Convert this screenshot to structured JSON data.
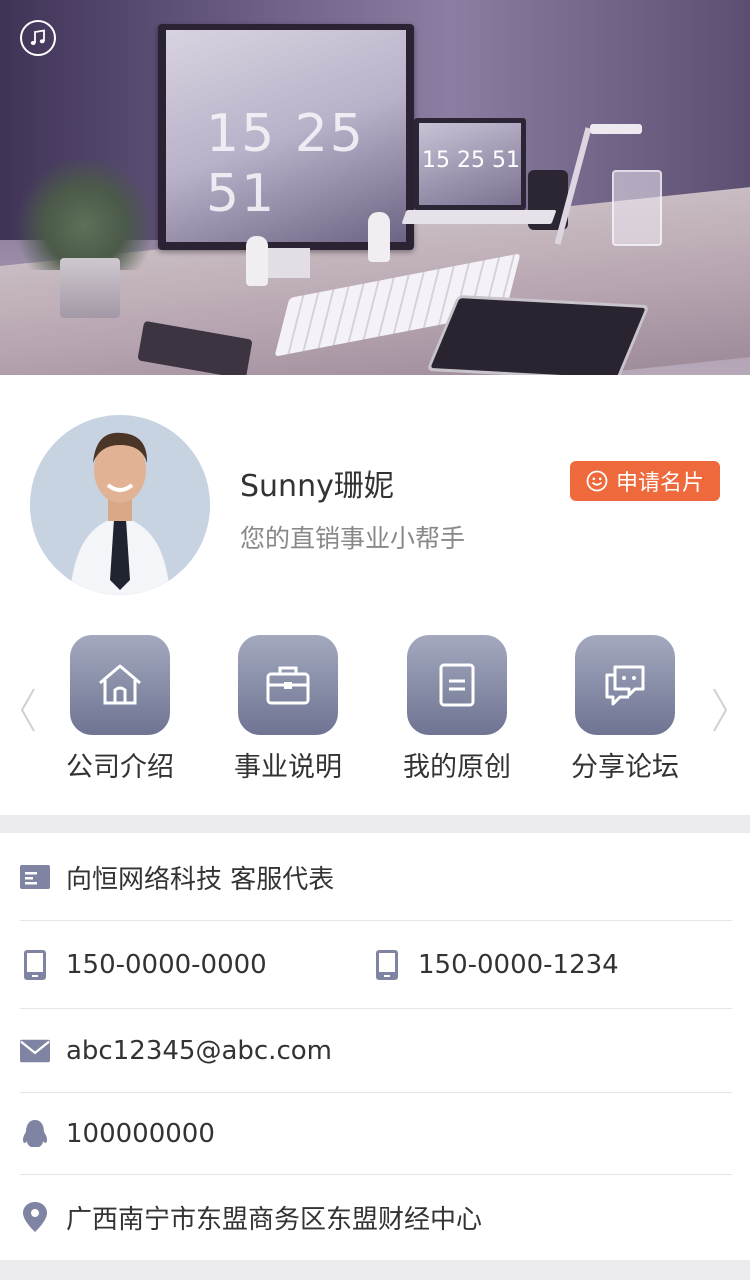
{
  "hero": {
    "clock_main": "15 25 51",
    "clock_laptop": "15 25 51",
    "music_icon": "music-note-icon"
  },
  "profile": {
    "name": "Sunny珊妮",
    "subtitle": "您的直销事业小帮手",
    "apply_button_label": "申请名片",
    "accent_color": "#ee6a3c"
  },
  "nav": {
    "items": [
      {
        "label": "公司介绍",
        "icon": "home-icon"
      },
      {
        "label": "事业说明",
        "icon": "briefcase-icon"
      },
      {
        "label": "我的原创",
        "icon": "document-icon"
      },
      {
        "label": "分享论坛",
        "icon": "chat-icon"
      }
    ]
  },
  "info": {
    "company": "向恒网络科技 客服代表",
    "phone1": "150-0000-0000",
    "phone2": "150-0000-1234",
    "email": "abc12345@abc.com",
    "qq": "100000000",
    "address": "广西南宁市东盟商务区东盟财经中心"
  }
}
